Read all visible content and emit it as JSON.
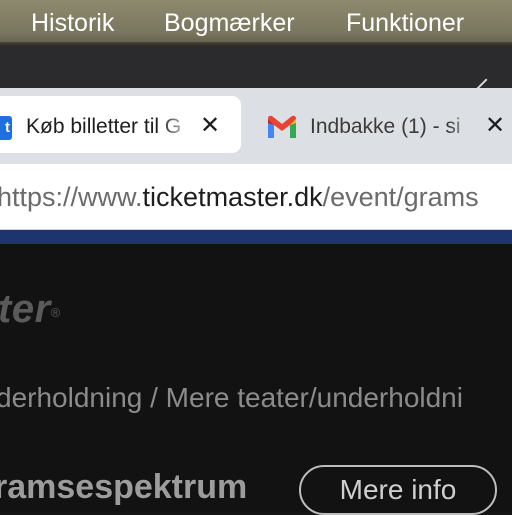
{
  "menubar": {
    "items": [
      "Historik",
      "Bogmærker",
      "Funktioner"
    ]
  },
  "tabs": [
    {
      "title": "Køb billetter til G",
      "icon": "ticketmaster-icon",
      "active": true
    },
    {
      "title": "Indbakke (1) - si",
      "icon": "gmail-icon",
      "active": false
    }
  ],
  "address_bar": {
    "prefix": "https://www.",
    "domain": "ticketmaster.dk",
    "path": "/event/grams"
  },
  "page": {
    "logo": "ter",
    "logo_mark": "®",
    "breadcrumb": "derholdning / Mere teater/underholdni",
    "event_title": "ramsespektrum",
    "more_info_button": "Mere info"
  },
  "colors": {
    "accent_bar": "#1e3470",
    "page_background": "#121212",
    "favicon": "#1f6fe0"
  }
}
